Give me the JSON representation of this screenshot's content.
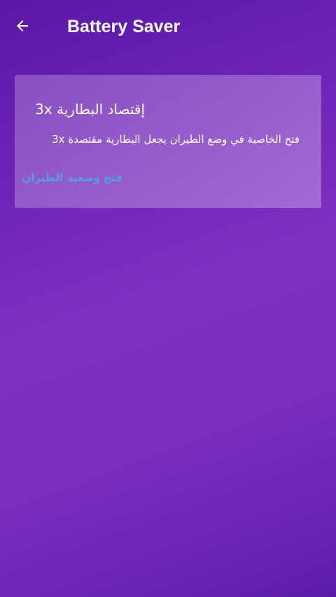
{
  "header": {
    "title": "Battery Saver",
    "back_icon": "arrow-left-icon"
  },
  "card": {
    "title": "إقتصاد البطارية 3x",
    "description": "فتح الخاصية في وضع الطيران يجعل البطارية مقتصدة 3x",
    "action_label": "فتح وضعية الطيران"
  },
  "colors": {
    "background_start": "#5a18a8",
    "background_mid": "#7e2fc0",
    "link": "#4fa3e8",
    "text": "#ffffff"
  }
}
